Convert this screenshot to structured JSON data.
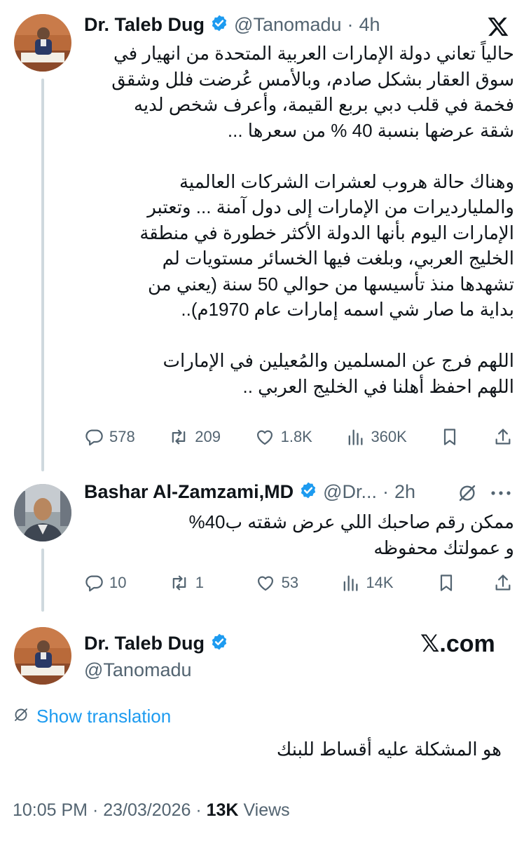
{
  "tweet1": {
    "display_name": "Dr. Taleb Dug",
    "handle": "@Tanomadu",
    "separator": "·",
    "time": "4h",
    "text": "حالياً تعاني دولة الإمارات العربية المتحدة من انهيار في\nسوق العقار بشكل صادم، وبالأمس عُرضت فلل وشقق\nفخمة في قلب دبي بربع القيمة، وأعرف شخص لديه\nشقة عرضها بنسبة 40 % من سعرها ...\n\nوهناك حالة هروب لعشرات الشركات العالمية\nوالمليارديرات من الإمارات إلى دول آمنة ... وتعتبر\nالإمارات اليوم بأنها الدولة الأكثر خطورة في منطقة\nالخليج العربي، وبلغت فيها الخسائر مستويات لم\nتشهدها منذ تأسيسها من حوالي 50 سنة (يعني من\nبداية ما صار شي اسمه إمارات عام 1970م)..\n\nاللهم فرج عن المسلمين والمُعيلين في الإمارات\nاللهم احفظ أهلنا في الخليج العربي ..",
    "replies": "578",
    "reposts": "209",
    "likes": "1.8K",
    "views": "360K"
  },
  "tweet2": {
    "display_name": "Bashar Al-Zamzami,MD",
    "handle": "@Dr...",
    "separator": "·",
    "time": "2h",
    "text": "ممكن رقم صاحبك اللي عرض شقته ب40%\nو عمولتك محفوظه",
    "replies": "10",
    "reposts": "1",
    "likes": "53",
    "views": "14K"
  },
  "tweet3": {
    "display_name": "Dr. Taleb Dug",
    "handle": "@Tanomadu",
    "brand": "𝕏.com",
    "show_translation": "Show translation",
    "text": "هو المشكلة عليه أقساط للبنك",
    "time": "10:05 PM",
    "date": "23/03/2026",
    "separator": "·",
    "views_count": "13K",
    "views_label": "Views"
  },
  "colors": {
    "accent": "#1d9bf0",
    "text": "#0f1419",
    "muted": "#536471",
    "thread_line": "#cfd9de"
  },
  "icons": [
    "x-logo-icon",
    "verified-badge-icon",
    "reply-icon",
    "repost-icon",
    "like-icon",
    "views-icon",
    "bookmark-icon",
    "share-icon",
    "grok-icon",
    "more-icon",
    "translate-icon"
  ]
}
